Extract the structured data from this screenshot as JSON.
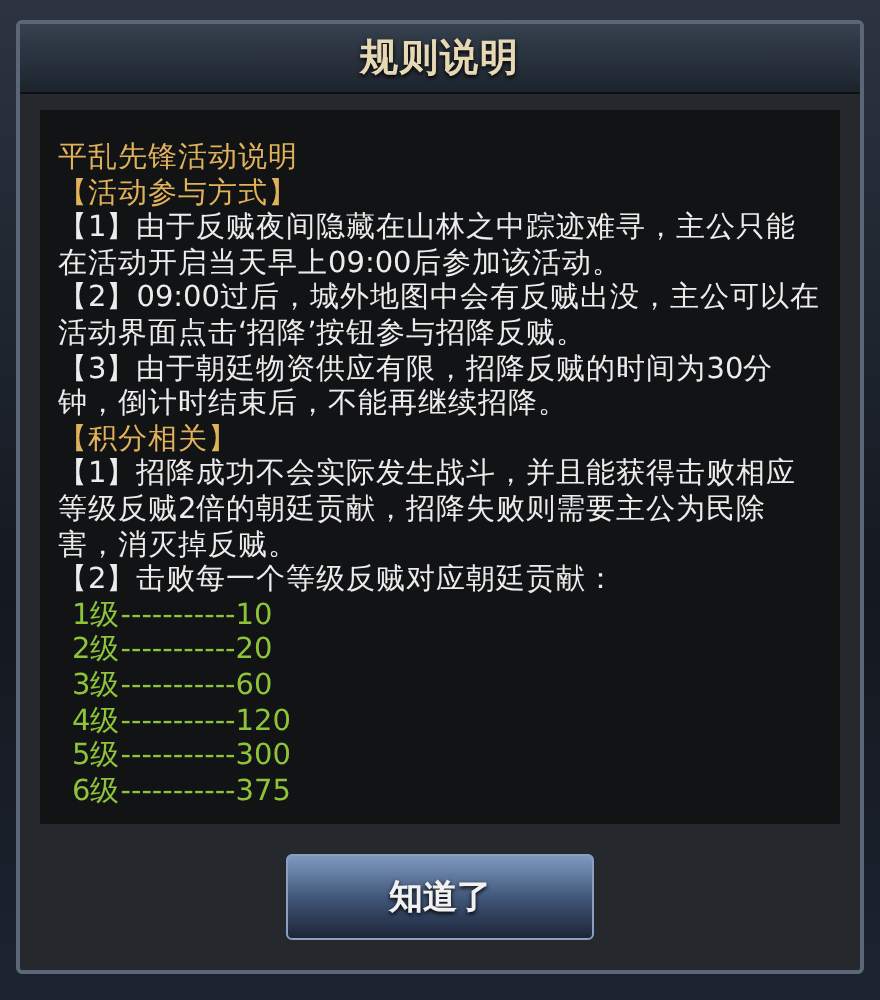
{
  "dialog": {
    "title": "规则说明",
    "lines": [
      {
        "kind": "title",
        "text": "平乱先锋活动说明"
      },
      {
        "kind": "section",
        "text": "【活动参与方式】"
      },
      {
        "kind": "para",
        "text": "【1】由于反贼夜间隐藏在山林之中踪迹难寻，主公只能在活动开启当天早上09:00后参加该活动。"
      },
      {
        "kind": "para",
        "text": "【2】09:00过后，城外地图中会有反贼出没，主公可以在活动界面点击‘招降’按钮参与招降反贼。"
      },
      {
        "kind": "para",
        "text": "【3】由于朝廷物资供应有限，招降反贼的时间为30分钟，倒计时结束后，不能再继续招降。"
      },
      {
        "kind": "section",
        "text": "【积分相关】"
      },
      {
        "kind": "para",
        "text": "【1】招降成功不会实际发生战斗，并且能获得击败相应等级反贼2倍的朝廷贡献，招降失败则需要主公为民除害，消灭掉反贼。"
      },
      {
        "kind": "para",
        "text": "【2】击败每一个等级反贼对应朝廷贡献："
      },
      {
        "kind": "level",
        "text": "1级-----------10"
      },
      {
        "kind": "level",
        "text": "2级-----------20"
      },
      {
        "kind": "level",
        "text": "3级-----------60"
      },
      {
        "kind": "level",
        "text": "4级-----------120"
      },
      {
        "kind": "level",
        "text": "5级-----------300"
      },
      {
        "kind": "level",
        "text": "6级-----------375"
      }
    ],
    "button": "知道了"
  }
}
